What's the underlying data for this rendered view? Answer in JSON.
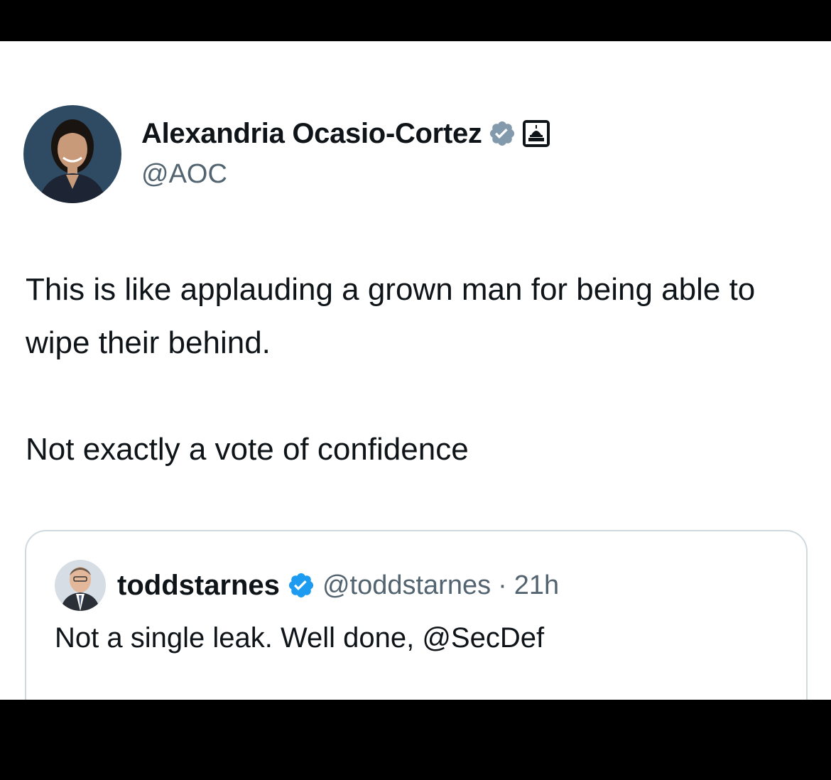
{
  "tweet": {
    "author": {
      "display_name": "Alexandria Ocasio-Cortez",
      "handle": "@AOC",
      "verified_icon": "verified-badge-icon",
      "affiliation_icon": "government-capitol-icon"
    },
    "text_paragraph_1": "This is like applauding a grown man for being able to wipe their behind.",
    "text_paragraph_2": "Not exactly a vote of confidence"
  },
  "quoted_tweet": {
    "author": {
      "display_name": "toddstarnes",
      "handle": "@toddstarnes",
      "verified_icon": "verified-badge-icon"
    },
    "separator": "·",
    "time": "21h",
    "text": "Not a single leak. Well done, @SecDef"
  },
  "colors": {
    "primary_text": "#0f1419",
    "secondary_text": "#536471",
    "verified_blue": "#1d9bf0",
    "verified_gray": "#829aab",
    "card_border": "#cfd9de"
  }
}
